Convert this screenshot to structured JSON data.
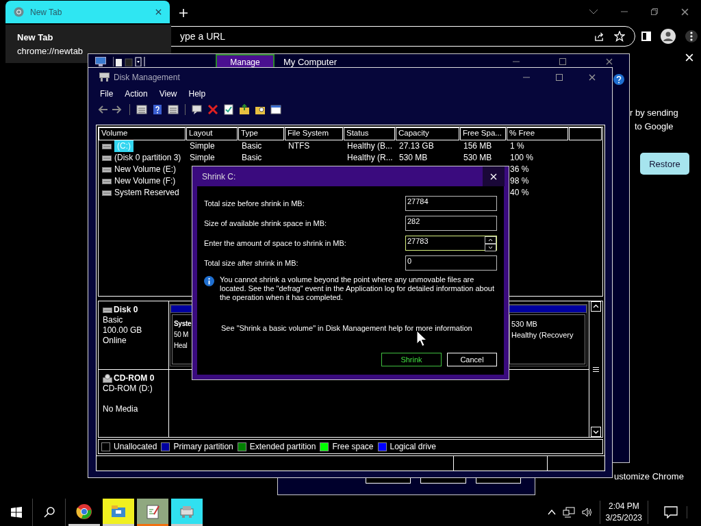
{
  "browser": {
    "tabs": [
      {
        "title": "New Tab",
        "selected": true
      }
    ],
    "tooltip": {
      "title": "New Tab",
      "url": "chrome://newtab"
    },
    "address_placeholder": "ype a URL",
    "side_text": [
      "r by sending",
      "to Google"
    ],
    "restore_button": "Restore",
    "customize_link": "ustomize Chrome"
  },
  "back_window": {
    "manage_button": "Manage",
    "title": "My Computer"
  },
  "disk_management": {
    "title": "Disk Management",
    "menu": [
      "File",
      "Action",
      "View",
      "Help"
    ],
    "columns": [
      "Volume",
      "Layout",
      "Type",
      "File System",
      "Status",
      "Capacity",
      "Free Spa...",
      "% Free"
    ],
    "rows": [
      {
        "volume": "(C:)",
        "layout": "Simple",
        "type": "Basic",
        "file_system": "NTFS",
        "status": "Healthy (B...",
        "capacity": "27.13 GB",
        "free_space": "156 MB",
        "percent_free": "1 %",
        "selected": true
      },
      {
        "volume": "(Disk 0 partition 3)",
        "layout": "Simple",
        "type": "Basic",
        "status": "Healthy (R...",
        "capacity": "530 MB",
        "free_space": "530 MB",
        "percent_free": "100 %",
        "selected": false
      },
      {
        "volume": "New Volume (E:)",
        "percent_free": "36 %",
        "selected": false
      },
      {
        "volume": "New Volume (F:)",
        "percent_free": "98 %",
        "selected": false
      },
      {
        "volume": "System Reserved",
        "percent_free": "40 %",
        "selected": false
      }
    ],
    "disks": [
      {
        "kind": "hard",
        "name": "Disk 0",
        "lines": [
          "Basic",
          "100.00 GB"
        ],
        "status": "Online",
        "partitions": [
          {
            "lines": [
              "Syste",
              "50 M",
              "Heal"
            ]
          },
          {
            "lines": [
              "530 MB",
              "Healthy (Recovery"
            ]
          }
        ]
      },
      {
        "kind": "cdrom",
        "name": "CD-ROM 0",
        "lines": [
          "CD-ROM (D:)"
        ],
        "status": "No Media"
      }
    ],
    "legend": [
      {
        "label": "Unallocated",
        "color": "#000000"
      },
      {
        "label": "Primary partition",
        "color": "#0000a0"
      },
      {
        "label": "Extended partition",
        "color": "#008000"
      },
      {
        "label": "Free space",
        "color": "#00ff00"
      },
      {
        "label": "Logical drive",
        "color": "#0000ff"
      }
    ]
  },
  "dialog": {
    "title": "Shrink C:",
    "fields": [
      {
        "label": "Total size before shrink in MB:",
        "value": "27784",
        "kind": "readonly",
        "focused": false
      },
      {
        "label": "Size of available shrink space in MB:",
        "value": "282",
        "kind": "readonly",
        "focused": false
      },
      {
        "label": "Enter the amount of space to shrink in MB:",
        "value": "27783",
        "kind": "spin",
        "focused": true
      },
      {
        "label": "Total size after shrink in MB:",
        "value": "0",
        "kind": "readonly",
        "focused": false
      }
    ],
    "info": "You cannot shrink a volume beyond the point where any unmovable files are located. See the \"defrag\" event in the Application log for detailed information about the operation when it has completed.",
    "help": "See \"Shrink a basic volume\" in Disk Management help for more information",
    "buttons": [
      {
        "label": "Shrink",
        "default": true
      },
      {
        "label": "Cancel",
        "default": false
      }
    ]
  },
  "taskbar": {
    "apps": [
      {
        "kind": "chrome",
        "active": false
      },
      {
        "kind": "explorer",
        "active": false
      },
      {
        "kind": "notepad",
        "active": true
      },
      {
        "kind": "diskmgmt",
        "active": false
      }
    ],
    "time": "2:04 PM",
    "date": "3/25/2023"
  }
}
